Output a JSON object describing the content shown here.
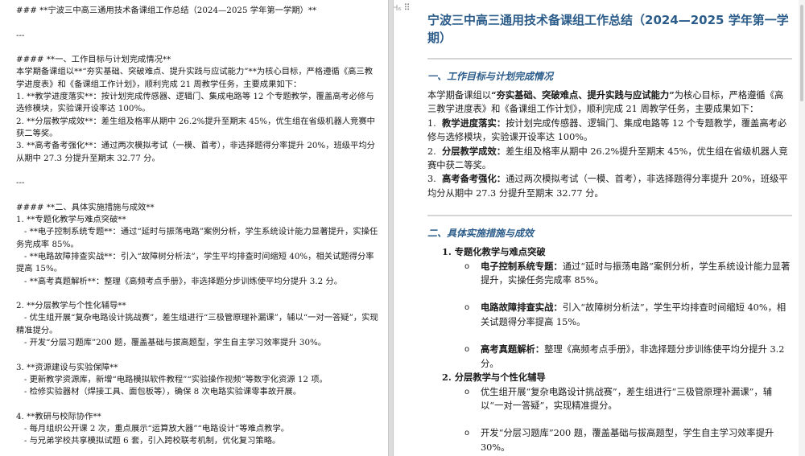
{
  "markdown_pane": {
    "lines": [
      "### **宁波三中高三通用技术备课组工作总结（2024—2025 学年第一学期）**",
      "",
      "---",
      "",
      "#### **一、工作目标与计划完成情况**",
      "本学期备课组以**“夯实基础、突破难点、提升实践与应试能力”**为核心目标，严格遵循《高三教学进度表》和《备课组工作计划》，顺利完成 21 周教学任务，主要成果如下：",
      "1. **教学进度落实**：按计划完成传感器、逻辑门、集成电路等 12 个专题教学，覆盖高考必修与选修模块，实验课开设率达 100%。",
      "2. **分层教学成效**：差生组及格率从期中 26.2%提升至期末 45%，优生组在省级机器人竞赛中获二等奖。",
      "3. **高考备考强化**：通过两次模拟考试（一模、首考），非选择题得分率提升 20%，班级平均分从期中 27.3 分提升至期末 32.77 分。",
      "",
      "---",
      "",
      "#### **二、具体实施措施与成效**",
      "1. **专题化教学与难点突破**",
      "   - **电子控制系统专题**：通过“延时与振荡电路”案例分析，学生系统设计能力显著提升，实操任务完成率 85%。",
      "   - **电路故障排查实战**：引入“故障树分析法”，学生平均排查时间缩短 40%，相关试题得分率提高 15%。",
      "   - **高考真题解析**：整理《高频考点手册》，非选择题分步训练使平均分提升 3.2 分。",
      "",
      "2. **分层教学与个性化辅导**",
      "   - 优生组开展“复杂电路设计挑战赛”，差生组进行“三极管原理补漏课”，辅以“一对一答疑”，实现精准提分。",
      "   - 开发“分层习题库”200 题，覆盖基础与拔高题型，学生自主学习效率提升 30%。",
      "",
      "3. **资源建设与实验保障**",
      "   - 更新教学资源库，新增“电路模拟软件教程”“实验操作视频”等数字化资源 12 项。",
      "   - 检修实验器材（焊接工具、面包板等），确保 8 次电路实验课零事故开展。",
      "",
      "4. **教研与校际协作**",
      "   - 每月组织公开课 2 次，重点展示“运算放大器”“电路设计”等难点教学。",
      "   - 与兄弟学校共享模拟试题 6 套，引入跨校联考机制，优化复习策略。",
      "",
      "---"
    ]
  },
  "preview_pane": {
    "heading_handle": "H₆",
    "title": "宁波三中高三通用技术备课组工作总结（2024—2025 学年第一学期）",
    "section1": {
      "heading": "一、工作目标与计划完成情况",
      "intro_pre": "本学期备课组以",
      "intro_bold": "“夯实基础、突破难点、提升实践与应试能力”",
      "intro_post": "为核心目标，严格遵循《高三教学进度表》和《备课组工作计划》，顺利完成 21 周教学任务，主要成果如下：",
      "items": [
        {
          "num": "1.",
          "bold": "教学进度落实：",
          "text": "按计划完成传感器、逻辑门、集成电路等 12 个专题教学，覆盖高考必修与选修模块，实验课开设率达 100%。"
        },
        {
          "num": "2.",
          "bold": "分层教学成效：",
          "text": "差生组及格率从期中 26.2%提升至期末 45%，优生组在省级机器人竞赛中获二等奖。"
        },
        {
          "num": "3.",
          "bold": "高考备考强化：",
          "text": "通过两次模拟考试（一模、首考），非选择题得分率提升 20%，班级平均分从期中 27.3 分提升至期末 32.77 分。"
        }
      ]
    },
    "section2": {
      "heading": "二、具体实施措施与成效",
      "groups": [
        {
          "title": "1. 专题化教学与难点突破",
          "items": [
            {
              "bold": "电子控制系统专题：",
              "text": "通过“延时与振荡电路”案例分析，学生系统设计能力显著提升，实操任务完成率 85%。"
            },
            {
              "bold": "电路故障排查实战：",
              "text": "引入“故障树分析法”，学生平均排查时间缩短 40%，相关试题得分率提高 15%。"
            },
            {
              "bold": "高考真题解析：",
              "text": "整理《高频考点手册》，非选择题分步训练使平均分提升 3.2 分。"
            }
          ]
        },
        {
          "title": "2. 分层教学与个性化辅导",
          "items": [
            {
              "bold": "",
              "text": "优生组开展“复杂电路设计挑战赛”，差生组进行“三极管原理补漏课”，辅以“一对一答疑”，实现精准提分。"
            },
            {
              "bold": "",
              "text": "开发“分层习题库”200 题，覆盖基础与拔高题型，学生自主学习效率提升 30%。"
            }
          ]
        },
        {
          "title": "3. 资源建设与实验保障",
          "items": []
        }
      ]
    },
    "bullet_glyph": "o"
  }
}
